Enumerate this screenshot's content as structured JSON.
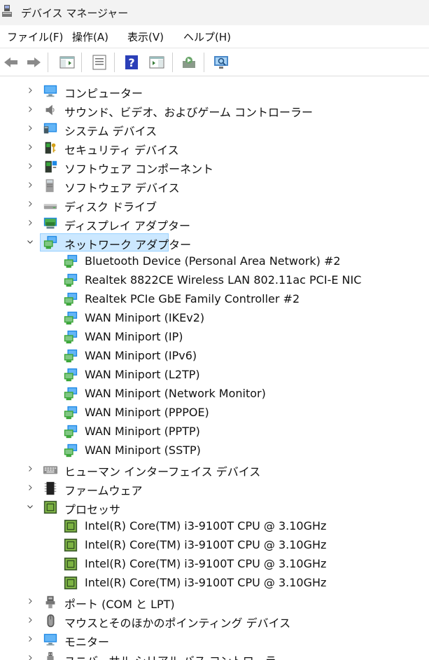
{
  "window": {
    "title": "デバイス マネージャー",
    "icon": "device-manager-icon"
  },
  "menu": [
    "ファイル(F)",
    "操作(A)",
    "表示(V)",
    "ヘルプ(H)"
  ],
  "toolbar": [
    {
      "name": "back-arrow-icon"
    },
    {
      "name": "forward-arrow-icon"
    },
    {
      "name": "show-hide-console-tree-icon"
    },
    {
      "name": "properties-icon"
    },
    {
      "name": "help-icon"
    },
    {
      "name": "action-pane-icon"
    },
    {
      "name": "update-driver-icon"
    },
    {
      "name": "scan-hardware-changes-icon"
    }
  ],
  "tree": {
    "categories": [
      {
        "label": "コンピューター",
        "icon": "computer-icon",
        "expanded": false
      },
      {
        "label": "サウンド、ビデオ、およびゲーム コントローラー",
        "icon": "speaker-icon",
        "expanded": false
      },
      {
        "label": "システム デバイス",
        "icon": "system-devices-icon",
        "expanded": false
      },
      {
        "label": "セキュリティ デバイス",
        "icon": "security-key-icon",
        "expanded": false
      },
      {
        "label": "ソフトウェア コンポーネント",
        "icon": "software-component-icon",
        "expanded": false
      },
      {
        "label": "ソフトウェア デバイス",
        "icon": "software-device-icon",
        "expanded": false
      },
      {
        "label": "ディスク ドライブ",
        "icon": "disk-drive-icon",
        "expanded": false
      },
      {
        "label": "ディスプレイ アダプター",
        "icon": "display-adapter-icon",
        "expanded": false
      },
      {
        "label": "ネットワーク アダプター",
        "icon": "network-adapter-icon",
        "expanded": true,
        "selected": true,
        "children": [
          "Bluetooth Device (Personal Area Network) #2",
          "Realtek 8822CE Wireless LAN 802.11ac PCI-E NIC",
          "Realtek PCIe GbE Family Controller #2",
          "WAN Miniport (IKEv2)",
          "WAN Miniport (IP)",
          "WAN Miniport (IPv6)",
          "WAN Miniport (L2TP)",
          "WAN Miniport (Network Monitor)",
          "WAN Miniport (PPPOE)",
          "WAN Miniport (PPTP)",
          "WAN Miniport (SSTP)"
        ],
        "child_icon": "network-adapter-icon"
      },
      {
        "label": "ヒューマン インターフェイス デバイス",
        "icon": "keyboard-hid-icon",
        "expanded": false
      },
      {
        "label": "ファームウェア",
        "icon": "firmware-icon",
        "expanded": false
      },
      {
        "label": "プロセッサ",
        "icon": "processor-icon",
        "expanded": true,
        "children": [
          "Intel(R) Core(TM) i3-9100T CPU @ 3.10GHz",
          "Intel(R) Core(TM) i3-9100T CPU @ 3.10GHz",
          "Intel(R) Core(TM) i3-9100T CPU @ 3.10GHz",
          "Intel(R) Core(TM) i3-9100T CPU @ 3.10GHz"
        ],
        "child_icon": "processor-icon"
      },
      {
        "label": "ポート (COM と LPT)",
        "icon": "port-icon",
        "expanded": false
      },
      {
        "label": "マウスとそのほかのポインティング デバイス",
        "icon": "mouse-icon",
        "expanded": false
      },
      {
        "label": "モニター",
        "icon": "monitor-icon",
        "expanded": false
      },
      {
        "label": "ユニバーサル シリアル バス コントローラー",
        "icon": "usb-icon",
        "expanded": false
      }
    ]
  },
  "colors": {
    "selection_bg": "#cce8ff",
    "selection_border": "#99d1ff",
    "network_green": "#3aa537",
    "monitor_blue": "#1e88e5"
  }
}
